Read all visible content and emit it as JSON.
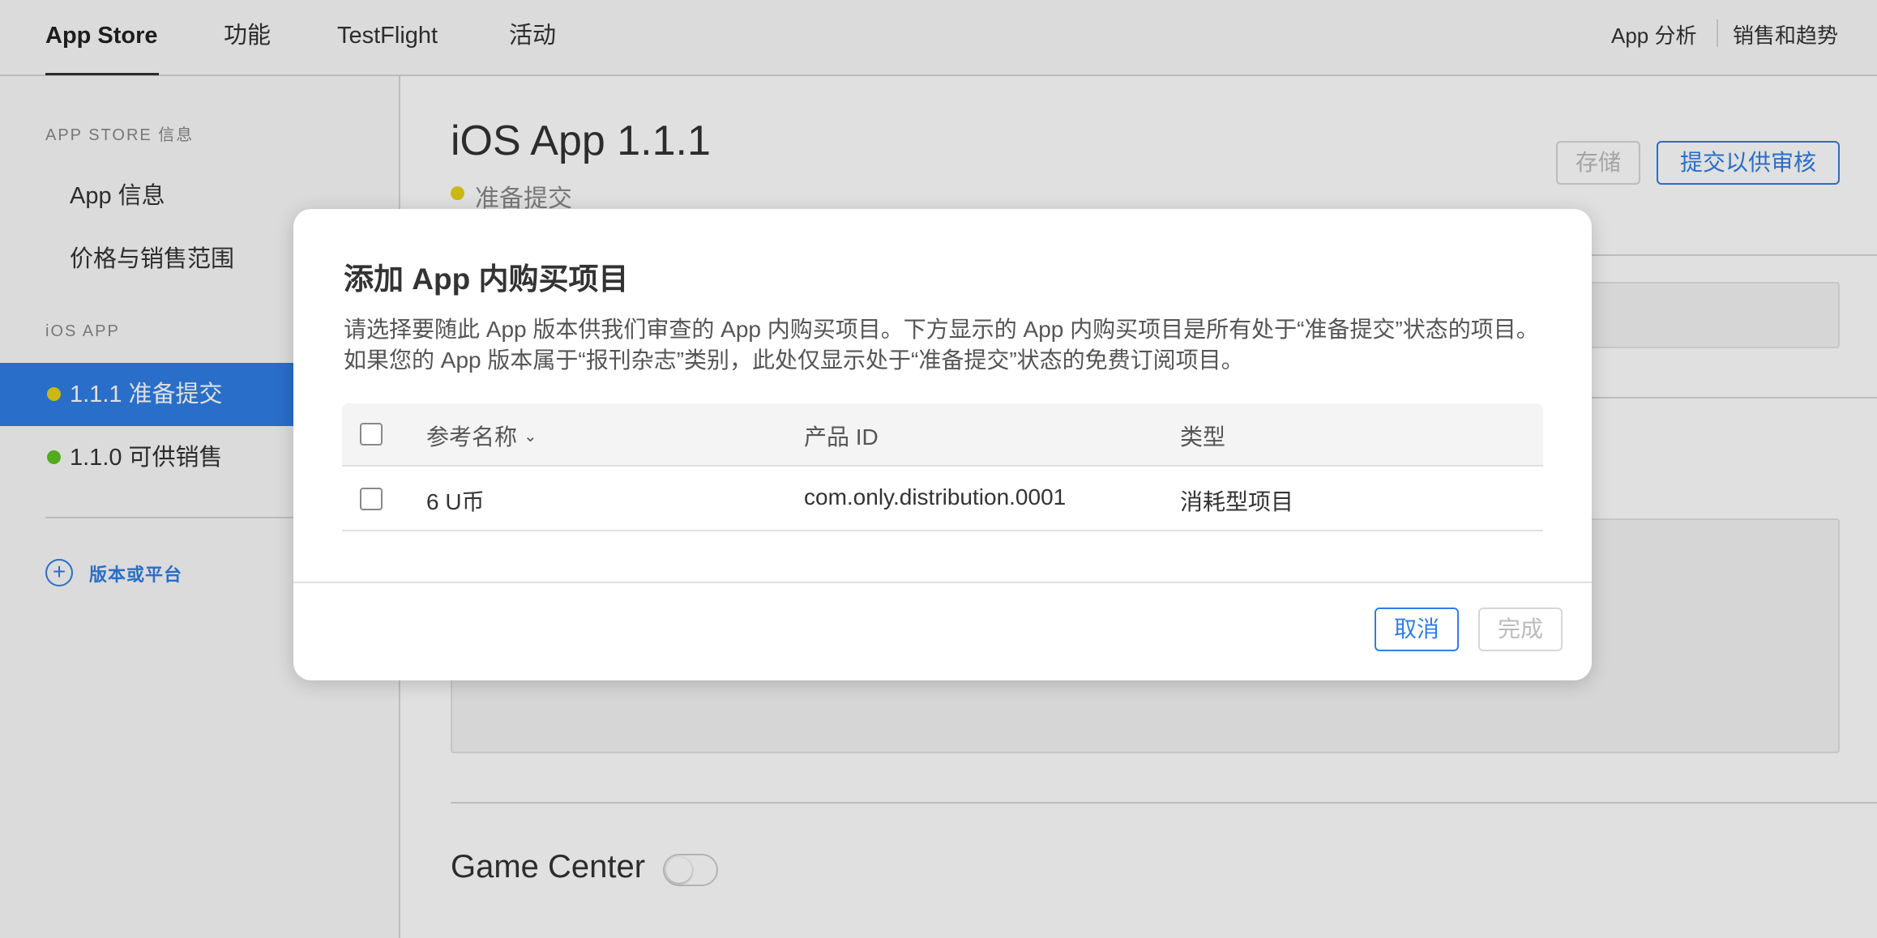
{
  "nav": {
    "tabs": [
      "App Store",
      "功能",
      "TestFlight",
      "活动"
    ],
    "right": [
      "App 分析",
      "销售和趋势"
    ]
  },
  "sidebar": {
    "section_store": "APP STORE 信息",
    "store_items": [
      "App 信息",
      "价格与销售范围"
    ],
    "section_ios": "iOS APP",
    "versions": [
      {
        "label": "1.1.1 准备提交",
        "status_color": "#e8d217",
        "active": true
      },
      {
        "label": "1.1.0 可供销售",
        "status_color": "#5ec222",
        "active": false
      }
    ],
    "add_label": "版本或平台"
  },
  "main": {
    "title": "iOS App 1.1.1",
    "status": "准备提交",
    "status_color": "#e8d217",
    "save_label": "存储",
    "submit_label": "提交以供审核",
    "game_center_label": "Game Center",
    "game_center_enabled": false
  },
  "modal": {
    "title": "添加 App 内购买项目",
    "description": "请选择要随此 App 版本供我们审查的 App 内购买项目。下方显示的 App 内购买项目是所有处于“准备提交”状态的项目。如果您的 App 版本属于“报刊杂志”类别，此处仅显示处于“准备提交”状态的免费订阅项目。",
    "columns": {
      "name": "参考名称",
      "product_id": "产品 ID",
      "type": "类型"
    },
    "rows": [
      {
        "name": "6 U币",
        "product_id": "com.only.distribution.0001",
        "type": "消耗型项目",
        "checked": false
      }
    ],
    "cancel_label": "取消",
    "done_label": "完成"
  },
  "colors": {
    "accent": "#2f7ee5",
    "ready": "#e8d217",
    "live": "#5ec222"
  }
}
